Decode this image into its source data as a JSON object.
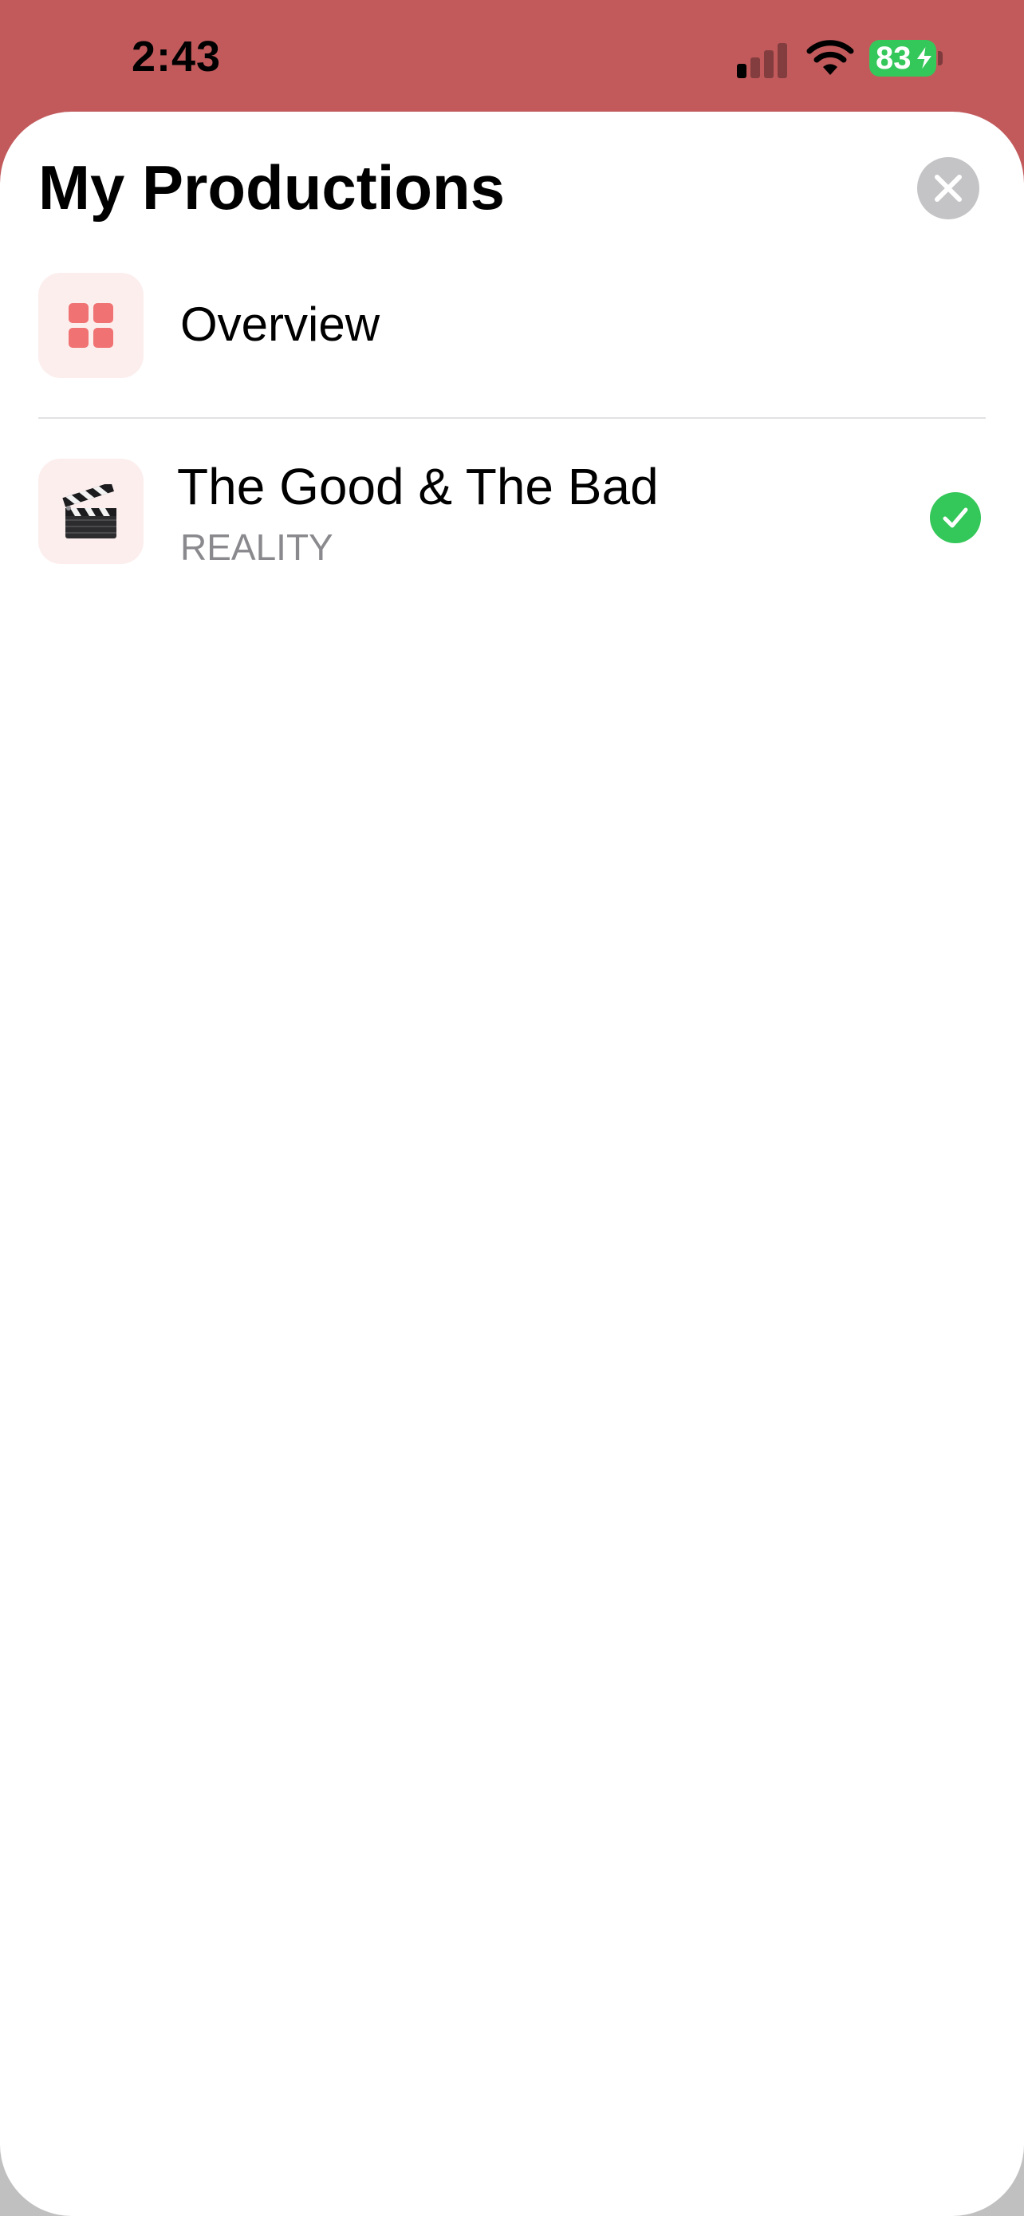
{
  "status_bar": {
    "time": "2:43",
    "battery_level": "83",
    "signal_bars_active": 1,
    "signal_bars_total": 4,
    "charging": true
  },
  "sheet": {
    "title": "My Productions",
    "close_icon": "close-icon"
  },
  "rows": {
    "overview": {
      "label": "Overview",
      "icon": "grid-icon"
    },
    "production": {
      "title": "The Good & The Bad",
      "subtitle": "REALITY",
      "icon": "clapperboard-icon",
      "selected": true
    }
  },
  "colors": {
    "status_background": "#c25a5c",
    "sheet_background": "#ffffff",
    "accent_pink": "#f07272",
    "tile_background": "#fdeeee",
    "check_green": "#34c759",
    "secondary_text": "#8a8a8e"
  }
}
